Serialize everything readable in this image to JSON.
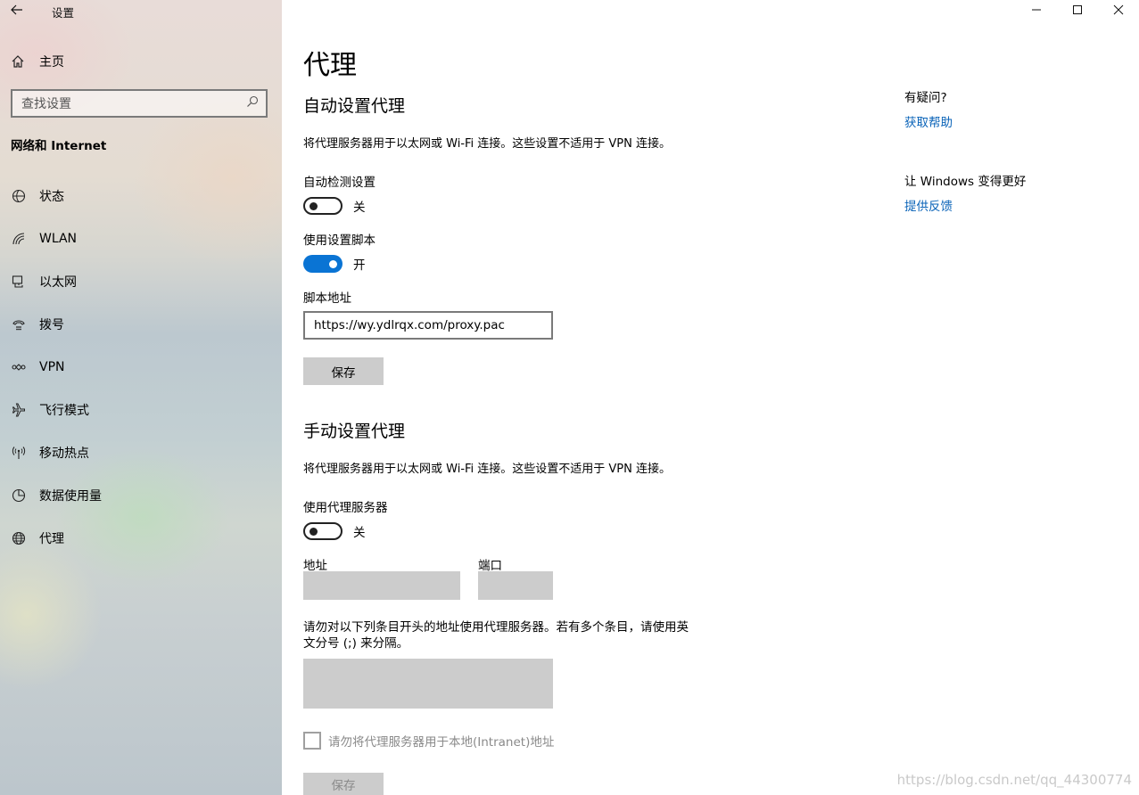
{
  "window": {
    "title": "设置"
  },
  "sidebar": {
    "home_label": "主页",
    "search_placeholder": "查找设置",
    "section_title": "网络和 Internet",
    "items": [
      {
        "label": "状态",
        "icon": "status-icon"
      },
      {
        "label": "WLAN",
        "icon": "wifi-icon"
      },
      {
        "label": "以太网",
        "icon": "ethernet-icon"
      },
      {
        "label": "拨号",
        "icon": "dialup-icon"
      },
      {
        "label": "VPN",
        "icon": "vpn-icon"
      },
      {
        "label": "飞行模式",
        "icon": "airplane-icon"
      },
      {
        "label": "移动热点",
        "icon": "hotspot-icon"
      },
      {
        "label": "数据使用量",
        "icon": "data-usage-icon"
      },
      {
        "label": "代理",
        "icon": "globe-icon"
      }
    ]
  },
  "main": {
    "title": "代理",
    "auto": {
      "heading": "自动设置代理",
      "description": "将代理服务器用于以太网或 Wi-Fi 连接。这些设置不适用于 VPN 连接。",
      "detect_label": "自动检测设置",
      "detect_state": "关",
      "detect_on": false,
      "script_label": "使用设置脚本",
      "script_state": "开",
      "script_on": true,
      "address_label": "脚本地址",
      "address_value": "https://wy.ydlrqx.com/proxy.pac",
      "save_label": "保存"
    },
    "manual": {
      "heading": "手动设置代理",
      "description": "将代理服务器用于以太网或 Wi-Fi 连接。这些设置不适用于 VPN 连接。",
      "use_proxy_label": "使用代理服务器",
      "use_proxy_state": "关",
      "use_proxy_on": false,
      "address_label": "地址",
      "port_label": "端口",
      "exceptions_desc_line1": "请勿对以下列条目开头的地址使用代理服务器。若有多个条目，请使用英",
      "exceptions_desc_line2": "文分号 (;) 来分隔。",
      "local_checkbox_label": "请勿将代理服务器用于本地(Intranet)地址",
      "save_label": "保存"
    }
  },
  "aside": {
    "question": "有疑问?",
    "help_link": "获取帮助",
    "improve": "让 Windows 变得更好",
    "feedback_link": "提供反馈"
  },
  "watermark": "https://blog.csdn.net/qq_44300774",
  "colors": {
    "accent": "#0a74d4",
    "link": "#0a63b8",
    "disabled_bg": "#cccccc"
  }
}
